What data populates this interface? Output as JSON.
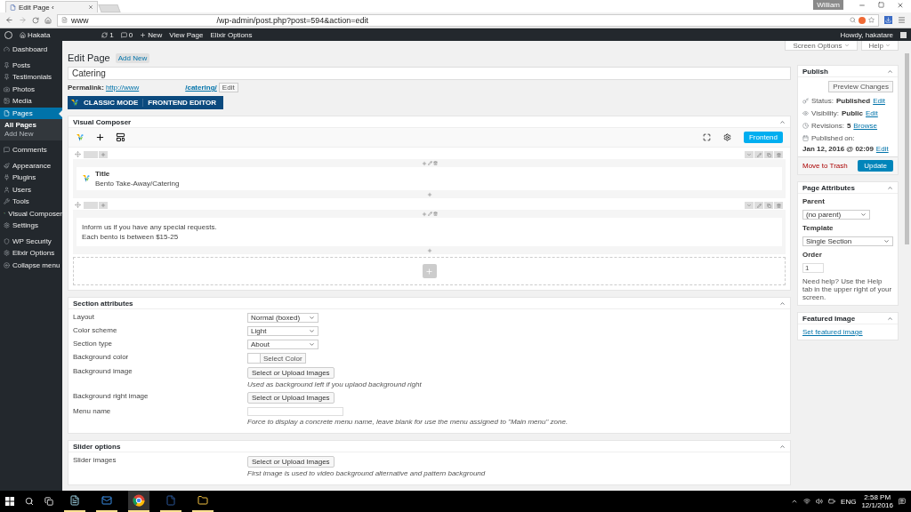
{
  "browser": {
    "tab_title": "Edit Page ‹",
    "profile": "William",
    "url_host": "www",
    "url_path": "/wp-admin/post.php?post=594&action=edit"
  },
  "admin_bar": {
    "site": "Hakata",
    "updates": "1",
    "comments": "0",
    "new": "New",
    "links": [
      "View Page",
      "Elixir Options"
    ],
    "greeting": "Howdy, hakatare"
  },
  "sidebar": {
    "items": [
      {
        "label": "Dashboard",
        "selected": false
      },
      {
        "label": "Posts",
        "selected": false
      },
      {
        "label": "Testimonials",
        "selected": false
      },
      {
        "label": "Photos",
        "selected": false
      },
      {
        "label": "Media",
        "selected": false
      },
      {
        "label": "Pages",
        "selected": true,
        "children": [
          {
            "label": "All Pages",
            "selected": true
          },
          {
            "label": "Add New",
            "selected": false
          }
        ]
      },
      {
        "label": "Comments",
        "selected": false
      },
      {
        "label": "Appearance",
        "selected": false
      },
      {
        "label": "Plugins",
        "selected": false
      },
      {
        "label": "Users",
        "selected": false
      },
      {
        "label": "Tools",
        "selected": false
      },
      {
        "label": "Visual Composer",
        "selected": false
      },
      {
        "label": "Settings",
        "selected": false
      },
      {
        "label": "WP Security",
        "selected": false
      },
      {
        "label": "Elixir Options",
        "selected": false
      },
      {
        "label": "Collapse menu",
        "selected": false
      }
    ]
  },
  "header": {
    "title": "Edit Page",
    "add_new": "Add New",
    "screen_options": "Screen Options",
    "help": "Help"
  },
  "post": {
    "title": "Catering",
    "permalink_label": "Permalink:",
    "permalink_host": "http://www",
    "permalink_slug": "/catering/",
    "edit": "Edit",
    "mode_buttons": [
      "CLASSIC MODE",
      "FRONTEND EDITOR"
    ]
  },
  "visual_composer": {
    "title": "Visual Composer",
    "frontend": "Frontend",
    "rows": [
      {
        "kind": "title",
        "heading": "Title",
        "text": "Bento Take-Away/Catering"
      },
      {
        "kind": "text",
        "lines": [
          "Inform us if you have any special requests.",
          "Each bento is between $15-25"
        ]
      }
    ]
  },
  "section_attributes": {
    "title": "Section attributes",
    "fields": [
      {
        "kind": "select",
        "label": "Layout",
        "value": "Normal (boxed)"
      },
      {
        "kind": "select",
        "label": "Color scheme",
        "value": "Light"
      },
      {
        "kind": "select",
        "label": "Section type",
        "value": "About"
      },
      {
        "kind": "color",
        "label": "Background color",
        "button": "Select Color"
      },
      {
        "kind": "upload",
        "label": "Background image",
        "button": "Select or Upload Images",
        "hint": "Used as background left if you uplaod background right"
      },
      {
        "kind": "upload",
        "label": "Background right image",
        "button": "Select or Upload Images"
      },
      {
        "kind": "text",
        "label": "Menu name",
        "hint": "Force to display a concrete menu name, leave blank for use the menu assigned to \"Main menu\" zone."
      }
    ]
  },
  "slider_options": {
    "title": "Slider options",
    "fields": [
      {
        "kind": "upload",
        "label": "Slider images",
        "button": "Select or Upload Images",
        "hint": "First image is used to video background alternative and pattern background"
      }
    ]
  },
  "publish": {
    "title": "Publish",
    "preview": "Preview Changes",
    "rows": [
      {
        "kind": "status",
        "label": "Status:",
        "value": "Published",
        "link": "Edit"
      },
      {
        "kind": "visibility",
        "label": "Visibility:",
        "value": "Public",
        "link": "Edit"
      },
      {
        "kind": "revisions",
        "label": "Revisions:",
        "value": "5",
        "link": "Browse"
      },
      {
        "kind": "date",
        "label": "Published on:",
        "value": "Jan 12, 2016 @ 02:09",
        "link": "Edit"
      }
    ],
    "trash": "Move to Trash",
    "update": "Update"
  },
  "page_attributes": {
    "title": "Page Attributes",
    "parent_label": "Parent",
    "parent": "(no parent)",
    "template_label": "Template",
    "template": "Single Section",
    "order_label": "Order",
    "order": "1",
    "help": "Need help? Use the Help tab in the upper right of your screen."
  },
  "featured_image": {
    "title": "Featured Image",
    "link": "Set featured image"
  },
  "taskbar": {
    "lang": "ENG",
    "time": "2:58 PM",
    "date": "12/1/2016"
  }
}
